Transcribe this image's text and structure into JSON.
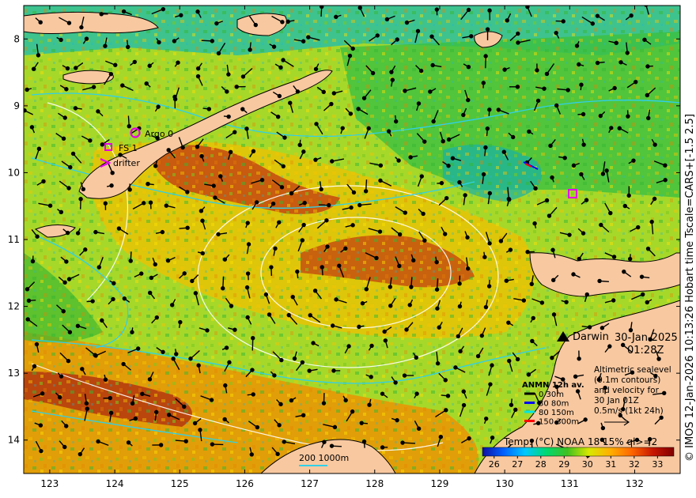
{
  "map": {
    "date_label": "30-Jan-2025",
    "time_label": "01:28Z",
    "side_caption": "© IMOS 12-Jan-2026 10:13:26 Hobart time Tscale=CARS+[-1.5 2.5]",
    "x_ticks": [
      "123",
      "124",
      "125",
      "126",
      "127",
      "128",
      "129",
      "130",
      "131",
      "132"
    ],
    "y_ticks": [
      "8",
      "9",
      "10",
      "11",
      "12",
      "13",
      "14"
    ],
    "y_values": [
      -8,
      -9,
      -10,
      -11,
      -12,
      -13,
      -14
    ],
    "x_values": [
      123,
      124,
      125,
      126,
      127,
      128,
      129,
      130,
      131,
      132
    ],
    "lon_range": [
      122.6,
      132.7
    ],
    "lat_range": [
      -14.5,
      -7.5
    ],
    "markers": {
      "argo": {
        "label": "Argo 0",
        "color": "#e600e6"
      },
      "fs": {
        "label": "FS 1",
        "color": "#e600e6"
      },
      "drifter": {
        "label": "drifter",
        "color": "#e600e6"
      },
      "darwin": {
        "label": "Darwin"
      }
    },
    "anmn_legend": {
      "title": "ANMN 12h av.",
      "items": [
        {
          "label": "0 30m",
          "color": "#000000"
        },
        {
          "label": "30 80m",
          "color": "#0000ff"
        },
        {
          "label": "80 150m",
          "color": "#00e5e5"
        },
        {
          "label": "150 300m",
          "color": "#ff0000"
        }
      ]
    },
    "altimetry_note": {
      "lines": [
        "Altimetric sealevel",
        "(0.1m contours)",
        "and velocity for",
        "30 Jan 01Z",
        "0.5m/s (1kt 24h)"
      ]
    },
    "depth_legend": {
      "label": "200  1000m"
    },
    "colorbar": {
      "title": "Temp. (°C) NOAA 18 15% ql>=2",
      "ticks": [
        "26",
        "27",
        "28",
        "29",
        "30",
        "31",
        "32",
        "33"
      ],
      "tick_values": [
        26,
        27,
        28,
        29,
        30,
        31,
        32,
        33
      ],
      "range": [
        25.5,
        33.7
      ],
      "colors": [
        "#1010a0",
        "#0060ff",
        "#00c8ff",
        "#00d870",
        "#40c020",
        "#d8e800",
        "#ffb000",
        "#ff6800",
        "#c81800",
        "#800000"
      ]
    }
  }
}
